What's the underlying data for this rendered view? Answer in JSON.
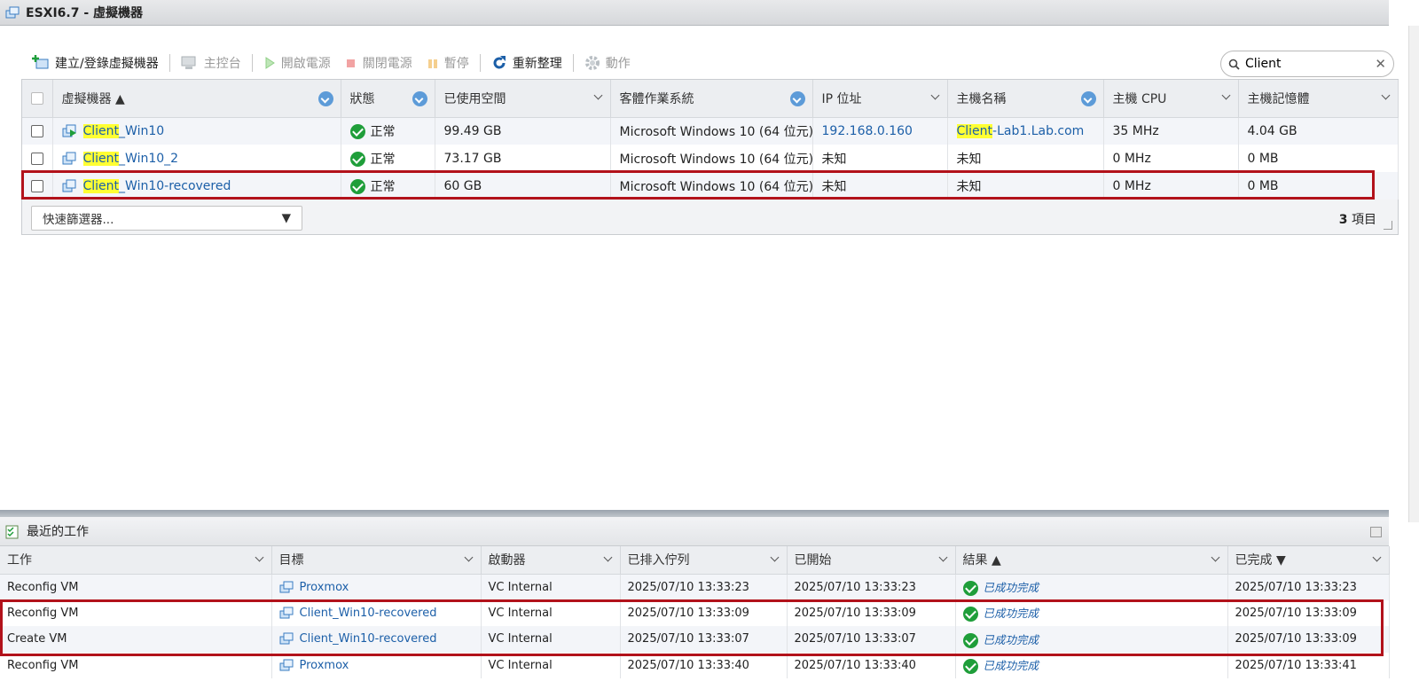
{
  "window": {
    "title": "ESXI6.7 - 虛擬機器"
  },
  "toolbar": {
    "create": "建立/登錄虛擬機器",
    "console": "主控台",
    "power_on": "開啟電源",
    "power_off": "關閉電源",
    "suspend": "暫停",
    "refresh": "重新整理",
    "actions": "動作"
  },
  "search": {
    "value": "Client"
  },
  "vm_table": {
    "headers": [
      "虛擬機器 ▲",
      "狀態",
      "已使用空間",
      "客體作業系統",
      "IP 位址",
      "主機名稱",
      "主機 CPU",
      "主機記憶體"
    ],
    "rows": [
      {
        "name_hl": "Client",
        "name_rest": "_Win10",
        "status": "正常",
        "used": "99.49 GB",
        "os": "Microsoft Windows 10 (64 位元)",
        "ip": "192.168.0.160",
        "host_hl": "Client",
        "host_rest": "-Lab1.Lab.com",
        "cpu": "35 MHz",
        "mem": "4.04 GB"
      },
      {
        "name_hl": "Client",
        "name_rest": "_Win10_2",
        "status": "正常",
        "used": "73.17 GB",
        "os": "Microsoft Windows 10 (64 位元)",
        "ip": "未知",
        "host_hl": "",
        "host_rest": "未知",
        "cpu": "0 MHz",
        "mem": "0 MB"
      },
      {
        "name_hl": "Client",
        "name_rest": "_Win10-recovered",
        "status": "正常",
        "used": "60 GB",
        "os": "Microsoft Windows 10 (64 位元)",
        "ip": "未知",
        "host_hl": "",
        "host_rest": "未知",
        "cpu": "0 MHz",
        "mem": "0 MB"
      }
    ],
    "quick_filter": "快速篩選器...",
    "count_num": "3",
    "count_label": " 項目"
  },
  "tasks": {
    "title": "最近的工作",
    "headers": [
      "工作",
      "目標",
      "啟動器",
      "已排入佇列",
      "已開始",
      "結果 ▲",
      "已完成 ▼"
    ],
    "rows": [
      {
        "task": "Reconfig VM",
        "target": "Proxmox",
        "initiator": "VC Internal",
        "queued": "2025/07/10 13:33:23",
        "started": "2025/07/10 13:33:23",
        "result": "已成功完成",
        "completed": "2025/07/10 13:33:23"
      },
      {
        "task": "Reconfig VM",
        "target": "Client_Win10-recovered",
        "initiator": "VC Internal",
        "queued": "2025/07/10 13:33:09",
        "started": "2025/07/10 13:33:09",
        "result": "已成功完成",
        "completed": "2025/07/10 13:33:09"
      },
      {
        "task": "Create VM",
        "target": "Client_Win10-recovered",
        "initiator": "VC Internal",
        "queued": "2025/07/10 13:33:07",
        "started": "2025/07/10 13:33:07",
        "result": "已成功完成",
        "completed": "2025/07/10 13:33:09"
      },
      {
        "task": "Reconfig VM",
        "target": "Proxmox",
        "initiator": "VC Internal",
        "queued": "2025/07/10 13:33:40",
        "started": "2025/07/10 13:33:40",
        "result": "已成功完成",
        "completed": "2025/07/10 13:33:41"
      }
    ]
  },
  "colors": {
    "accent": "#1c5fa8",
    "highlight": "#ffff33",
    "ok": "#1f9e3a",
    "annotation": "#b2121b"
  }
}
